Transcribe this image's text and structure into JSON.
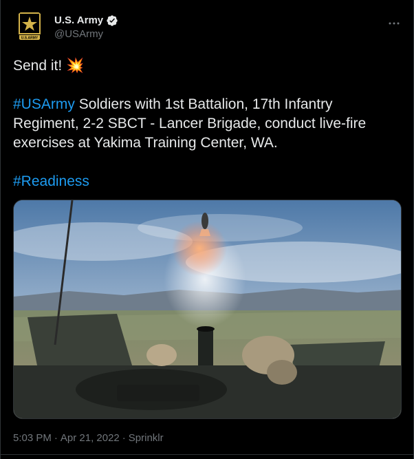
{
  "account": {
    "display_name": "U.S. Army",
    "handle": "@USArmy",
    "logo_text": "U.S.ARMY",
    "verified_icon": "verified-badge-icon"
  },
  "tweet": {
    "line1": "Send it! ",
    "line1_emoji": "💥",
    "hashtag1": "#USArmy",
    "body": " Soldiers with 1st Battalion, 17th Infantry Regiment, 2-2 SBCT - Lancer Brigade, conduct live-fire exercises at Yakima Training Center, WA.",
    "hashtag2": "#Readiness"
  },
  "meta": {
    "time": "5:03 PM",
    "sep1": "·",
    "date": "Apr 21, 2022",
    "sep2": "·",
    "source": "Sprinklr"
  },
  "more_icon": "more-options-icon",
  "colors": {
    "background": "#000000",
    "text": "#e7e9ea",
    "secondary": "#71767b",
    "link": "#1d9bf0",
    "verified": "#e7e9ea"
  }
}
